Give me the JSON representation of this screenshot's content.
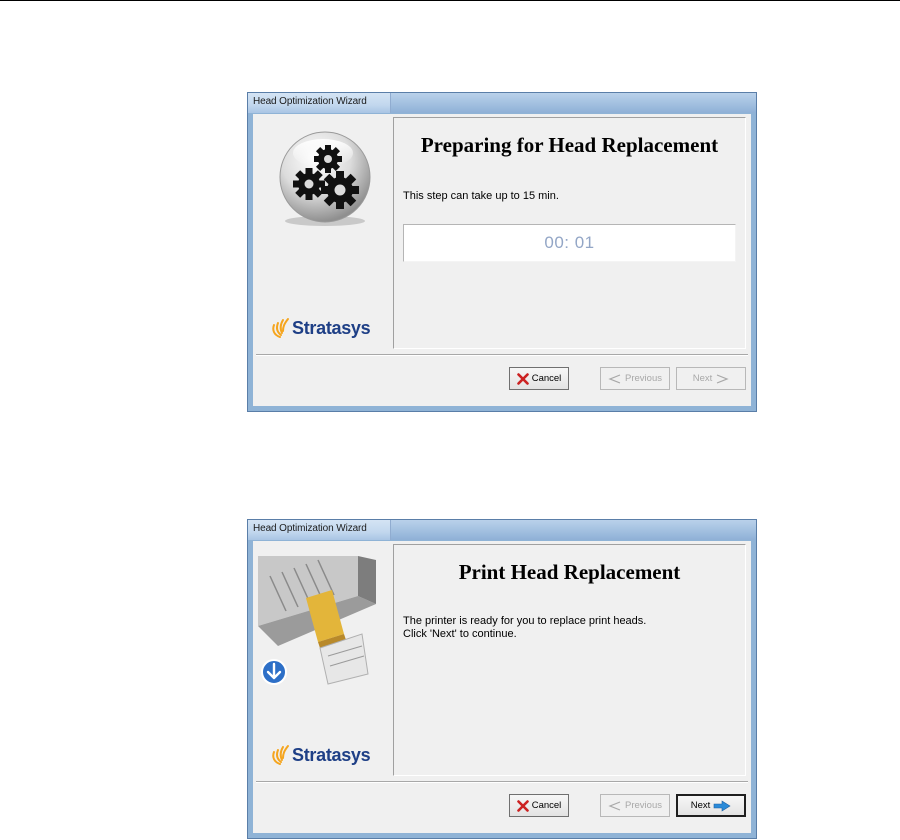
{
  "windows": [
    {
      "title": "Head Optimization Wizard",
      "heading": "Preparing for Head Replacement",
      "message_lines": [
        "This step can take up to 15 min."
      ],
      "timer": "00: 01",
      "logo_text": "Stratasys",
      "left_graphic": "gears-icon",
      "buttons": {
        "cancel": {
          "label": "Cancel",
          "enabled": true
        },
        "previous": {
          "label": "Previous",
          "enabled": false
        },
        "next": {
          "label": "Next",
          "enabled": false
        }
      }
    },
    {
      "title": "Head Optimization Wizard",
      "heading": "Print Head Replacement",
      "message_lines": [
        "The printer is ready for you to replace print heads.",
        "Click 'Next' to continue."
      ],
      "logo_text": "Stratasys",
      "left_graphic": "print-head-image",
      "buttons": {
        "cancel": {
          "label": "Cancel",
          "enabled": true
        },
        "previous": {
          "label": "Previous",
          "enabled": false
        },
        "next": {
          "label": "Next",
          "enabled": true
        }
      }
    }
  ],
  "colors": {
    "titlebar": "#a6c3e2",
    "dialog_bg": "#f0f0f0",
    "logo_blue": "#1e3f86",
    "logo_orange": "#f5a51e",
    "timer_text": "#93a6c6",
    "cancel_x": "#cc2222",
    "next_arrow": "#2a8ad8"
  }
}
